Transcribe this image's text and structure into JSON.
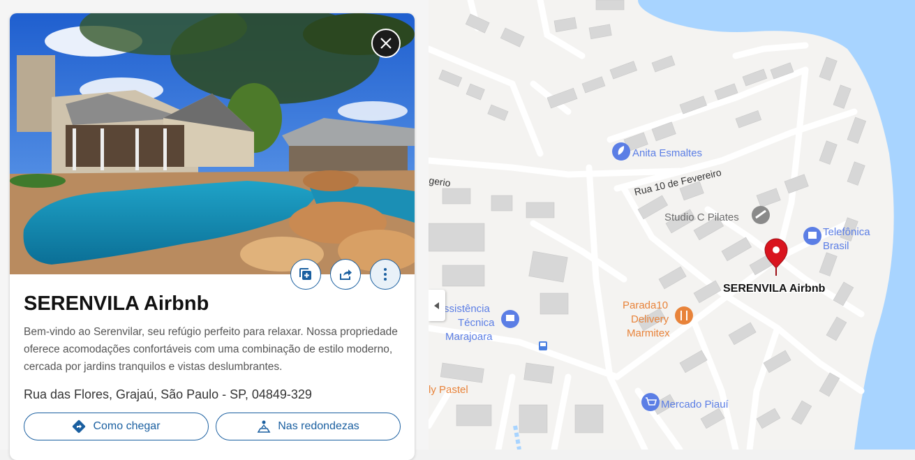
{
  "listing": {
    "title": "SERENVILA Airbnb",
    "description": "Bem-vindo ao Serenvilar, seu refúgio perfeito para relaxar. Nossa propriedade oferece acomodações confortáveis com uma combinação de estilo moderno, cercada por jardins tranquilos e vistas deslumbrantes.",
    "address": "Rua das Flores, Grajaú, São Paulo - SP, 04849-329",
    "photo_icon": "house-with-pool-photo",
    "actions": {
      "close_icon": "close-icon",
      "save_icon": "add-to-collection-icon",
      "share_icon": "share-icon",
      "more_icon": "more-vertical-icon",
      "directions_label": "Como chegar",
      "directions_icon": "directions-icon",
      "nearby_label": "Nas redondezas",
      "nearby_icon": "nearby-icon"
    }
  },
  "map": {
    "marker_label": "SERENVILA Airbnb",
    "streets": [
      "Rua 10 de Fevereiro",
      "gerio"
    ],
    "pois": [
      {
        "name": "Anita Esmaltes",
        "icon": "beauty-icon",
        "color": "#5b7ee5"
      },
      {
        "name": "Studio C Pilates",
        "icon": "gym-icon",
        "color": "#8a8a8a"
      },
      {
        "name_line1": "Telefônica",
        "name_line2": "Brasil",
        "icon": "company-icon",
        "color": "#5b7ee5"
      },
      {
        "name_line1": "Parada10",
        "name_line2": "Delivery",
        "name_line3": "Marmitex",
        "icon": "restaurant-icon",
        "color": "#e8833a"
      },
      {
        "name_line1": "ssistência",
        "name_line2": "Técnica",
        "name_line3": "Marajoara",
        "icon": "service-icon",
        "color": "#5b7ee5"
      },
      {
        "name": "Mercado Piauí",
        "icon": "shopping-cart-icon",
        "color": "#5b7ee5"
      },
      {
        "name": "ly Pastel",
        "icon": "restaurant-icon",
        "color": "#e8833a"
      }
    ],
    "colors": {
      "water": "#a8d4ff",
      "road": "#ffffff",
      "building": "#d6d6d6",
      "marker": "#d9141e"
    }
  }
}
